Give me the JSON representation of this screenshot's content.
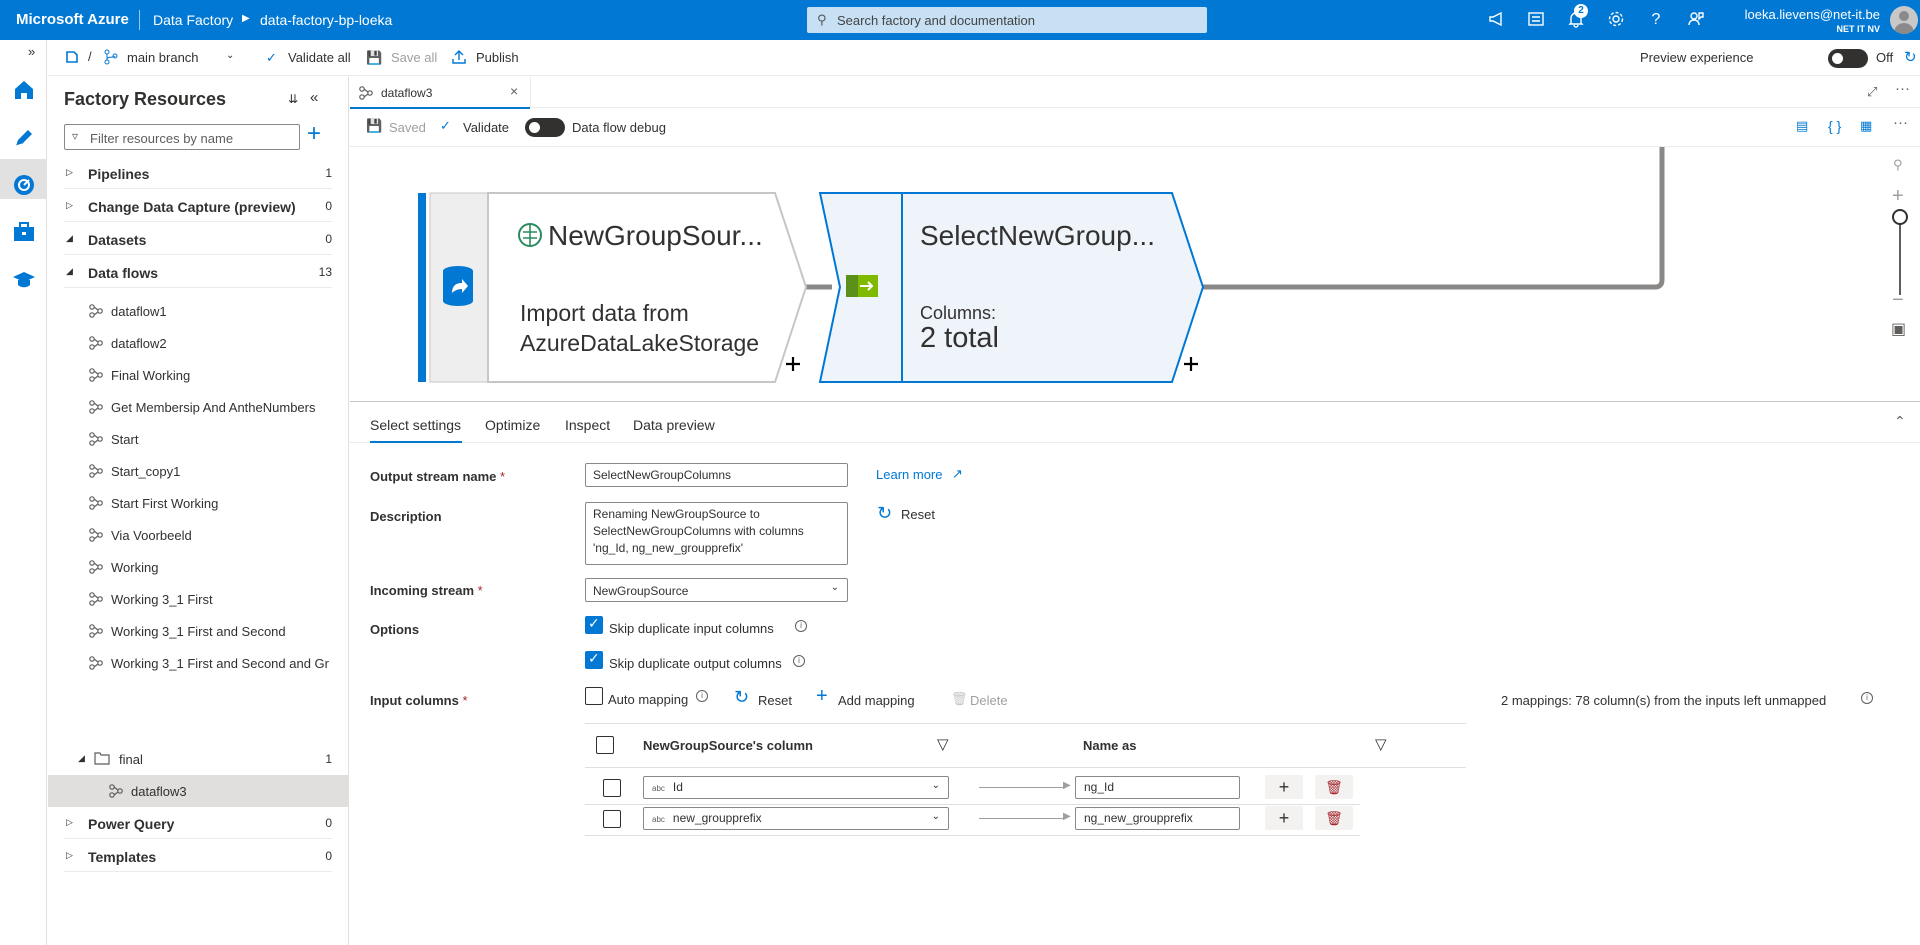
{
  "topbar": {
    "brand": "Microsoft Azure",
    "crumb_service": "Data Factory",
    "crumb_factory": "data-factory-bp-loeka",
    "search_placeholder": "Search factory and documentation",
    "notification_count": "2",
    "user_email": "loeka.lievens@net-it.be",
    "user_org": "NET IT NV"
  },
  "toolbar": {
    "branch": "main branch",
    "validate_all": "Validate all",
    "save_all": "Save all",
    "publish": "Publish",
    "preview_label": "Preview experience",
    "preview_state": "Off"
  },
  "resources": {
    "title": "Factory Resources",
    "filter_placeholder": "Filter resources by name",
    "sections": [
      {
        "label": "Pipelines",
        "count": "1"
      },
      {
        "label": "Change Data Capture (preview)",
        "count": "0"
      },
      {
        "label": "Datasets",
        "count": "0"
      },
      {
        "label": "Data flows",
        "count": "13"
      },
      {
        "label": "Power Query",
        "count": "0"
      },
      {
        "label": "Templates",
        "count": "0"
      }
    ],
    "dataflows": [
      "dataflow1",
      "dataflow2",
      "Final Working",
      "Get Membersip And AntheNumbers",
      "Start",
      "Start_copy1",
      "Start First Working",
      "Via Voorbeeld",
      "Working",
      "Working 3_1 First",
      "Working 3_1 First and Second",
      "Working 3_1 First and Second and Gr"
    ],
    "folder": {
      "label": "final",
      "count": "1"
    },
    "folder_item": "dataflow3"
  },
  "editor": {
    "tab_label": "dataflow3",
    "saved": "Saved",
    "validate": "Validate",
    "debug": "Data flow debug"
  },
  "canvas": {
    "source_title": "NewGroupSour...",
    "source_sub1": "Import data from",
    "source_sub2": "AzureDataLakeStorage",
    "select_title": "SelectNewGroup...",
    "select_sub1": "Columns:",
    "select_sub2": "2 total"
  },
  "settings": {
    "tabs": [
      "Select settings",
      "Optimize",
      "Inspect",
      "Data preview"
    ],
    "output_stream_label": "Output stream name",
    "output_stream_value": "SelectNewGroupColumns",
    "learn_more": "Learn more",
    "description_label": "Description",
    "description_value": "Renaming NewGroupSource to SelectNewGroupColumns with columns 'ng_Id, ng_new_groupprefix'",
    "reset": "Reset",
    "incoming_label": "Incoming stream",
    "incoming_value": "NewGroupSource",
    "options_label": "Options",
    "opt_input": "Skip duplicate input columns",
    "opt_output": "Skip duplicate output columns",
    "input_columns_label": "Input columns",
    "auto_mapping": "Auto mapping",
    "reset2": "Reset",
    "add_mapping": "Add mapping",
    "delete": "Delete",
    "mapping_summary": "2 mappings: 78 column(s) from the inputs left unmapped",
    "col_source_header": "NewGroupSource's column",
    "col_name_header": "Name as",
    "type_tag": "abc",
    "rows": [
      {
        "source": "Id",
        "target": "ng_Id"
      },
      {
        "source": "new_groupprefix",
        "target": "ng_new_groupprefix"
      }
    ]
  }
}
